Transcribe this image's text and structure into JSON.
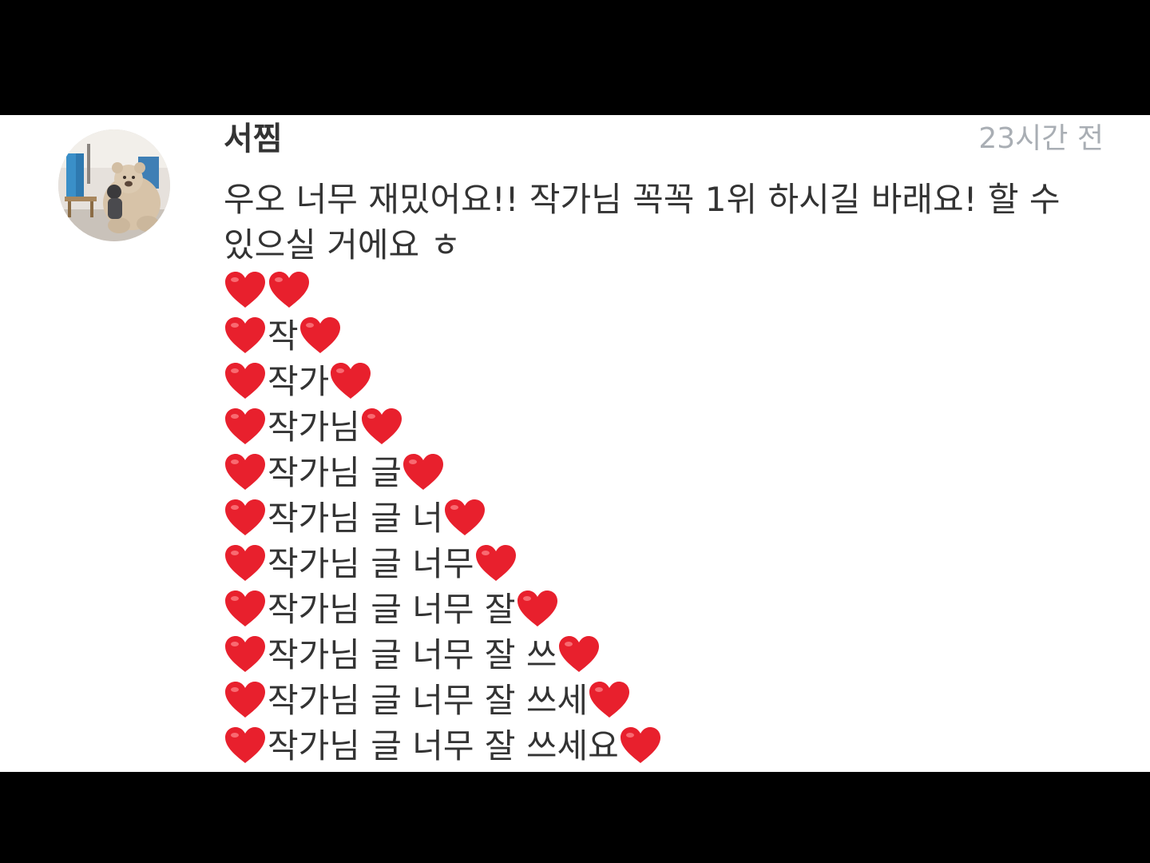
{
  "comment": {
    "author": "서찜",
    "timestamp": "23시간 전",
    "intro_text": "우오 너무 재밌어요!! 작가님 꼭꼭 1위 하시길 바래요! 할 수 있으실 거에요 ㅎ",
    "avatar_icon": "profile-photo-with-teddy-bear",
    "heart_icon": "red-heart-emoji",
    "heart_color": "#e8202d",
    "lines": [
      "",
      "작",
      "작가",
      "작가님",
      "작가님 글",
      "작가님 글 너",
      "작가님 글 너무",
      "작가님 글 너무 잘",
      "작가님 글 너무 잘 쓰",
      "작가님 글 너무 잘 쓰세",
      "작가님 글 너무 잘 쓰세요"
    ]
  }
}
